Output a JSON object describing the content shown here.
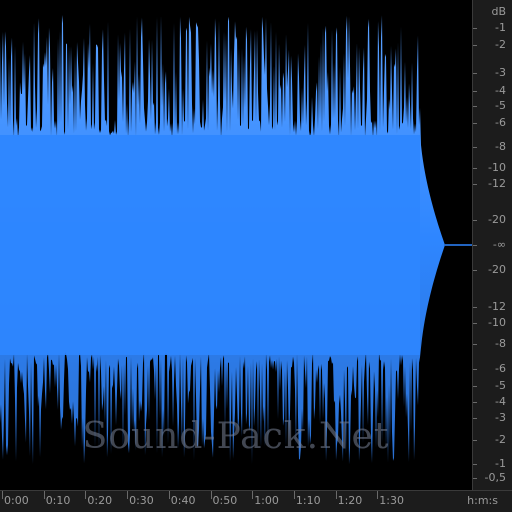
{
  "waveform": {
    "color_top": "#5aa0ff",
    "color_fill": "#2e86ff",
    "color_dark": "#1a3f7a",
    "background": "#000000"
  },
  "db_scale": {
    "unit": "dB",
    "top_labels": [
      "-1",
      "-2",
      "-3",
      "-4",
      "-5",
      "-6",
      "-8",
      "-10",
      "-12",
      "-20"
    ],
    "center_label": "-∞",
    "bottom_labels": [
      "-20",
      "-12",
      "-10",
      "-8",
      "-6",
      "-5",
      "-4",
      "-3",
      "-2",
      "-1",
      "-0,5"
    ]
  },
  "time_ruler": {
    "labels": [
      "0:00",
      "0:10",
      "0:20",
      "0:30",
      "0:40",
      "0:50",
      "1:00",
      "1:10",
      "1:20",
      "1:30"
    ],
    "unit_label": "h:m:s"
  },
  "watermark": "Sound-Pack.Net"
}
